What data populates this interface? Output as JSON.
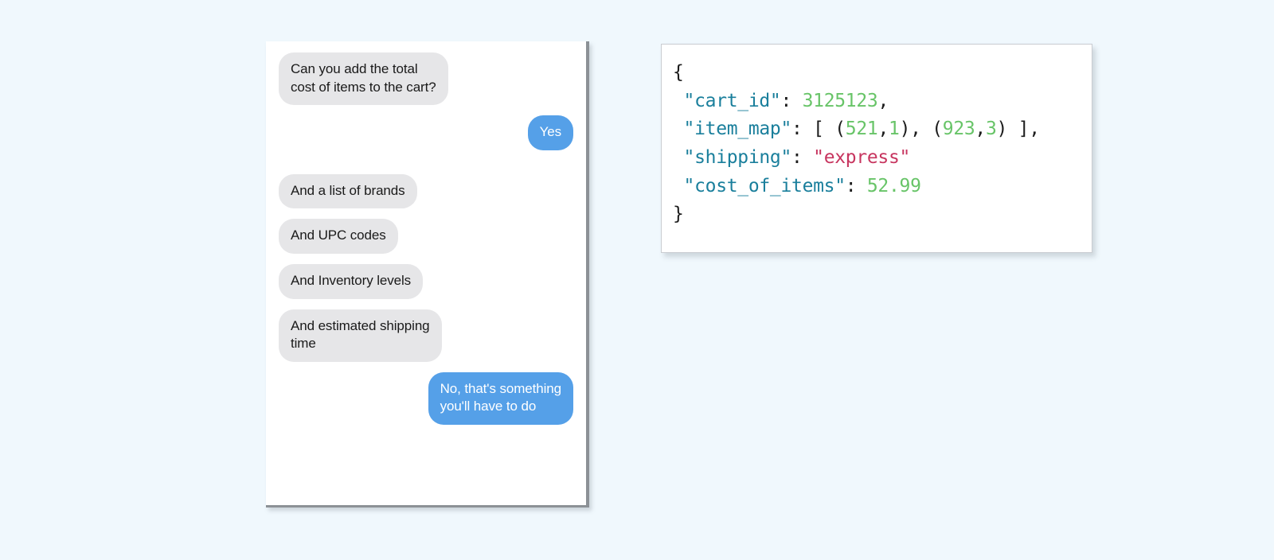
{
  "page": {
    "background_color": "#f0f8fd"
  },
  "chat": {
    "panel_name": "messaging-thread",
    "bubble_gray_color": "#e6e6e8",
    "bubble_blue_color": "#55a0e8",
    "messages": [
      {
        "side": "left",
        "sender": "them",
        "text": "Can you add the total\ncost of items to the cart?"
      },
      {
        "side": "right",
        "sender": "me",
        "text": "Yes"
      },
      {
        "side": "left",
        "sender": "them",
        "text": "And a list of brands"
      },
      {
        "side": "left",
        "sender": "them",
        "text": "And UPC codes"
      },
      {
        "side": "left",
        "sender": "them",
        "text": "And Inventory levels"
      },
      {
        "side": "left",
        "sender": "them",
        "text": "And estimated shipping\ntime"
      },
      {
        "side": "right",
        "sender": "me",
        "text": "No, that's something\nyou'll have to do"
      }
    ]
  },
  "code_panel": {
    "panel_name": "json-payload",
    "language": "json",
    "colors": {
      "key": "#1a7f9c",
      "number": "#68c468",
      "string": "#c7355f",
      "punctuation": "#1c1c1c"
    },
    "lines": [
      {
        "indent": 0,
        "tokens": [
          {
            "t": "punct",
            "v": "{"
          }
        ]
      },
      {
        "indent": 1,
        "tokens": [
          {
            "t": "key",
            "v": "\"cart_id\""
          },
          {
            "t": "punct",
            "v": ": "
          },
          {
            "t": "num",
            "v": "3125123"
          },
          {
            "t": "punct",
            "v": ","
          }
        ]
      },
      {
        "indent": 1,
        "tokens": [
          {
            "t": "key",
            "v": "\"item_map\""
          },
          {
            "t": "punct",
            "v": ": [ ("
          },
          {
            "t": "num",
            "v": "521"
          },
          {
            "t": "punct",
            "v": ","
          },
          {
            "t": "num",
            "v": "1"
          },
          {
            "t": "punct",
            "v": "), ("
          },
          {
            "t": "num",
            "v": "923"
          },
          {
            "t": "punct",
            "v": ","
          },
          {
            "t": "num",
            "v": "3"
          },
          {
            "t": "punct",
            "v": ") ],"
          }
        ]
      },
      {
        "indent": 1,
        "tokens": [
          {
            "t": "key",
            "v": "\"shipping\""
          },
          {
            "t": "punct",
            "v": ": "
          },
          {
            "t": "str",
            "v": "\"express\""
          }
        ]
      },
      {
        "indent": 1,
        "tokens": [
          {
            "t": "key",
            "v": "\"cost_of_items\""
          },
          {
            "t": "punct",
            "v": ": "
          },
          {
            "t": "num",
            "v": "52.99"
          }
        ]
      },
      {
        "indent": 0,
        "tokens": [
          {
            "t": "punct",
            "v": "}"
          }
        ]
      }
    ],
    "plain_text": "{\n \"cart_id\": 3125123,\n \"item_map\": [ (521,1), (923,3) ],\n \"shipping\": \"express\"\n \"cost_of_items\": 52.99\n}"
  }
}
